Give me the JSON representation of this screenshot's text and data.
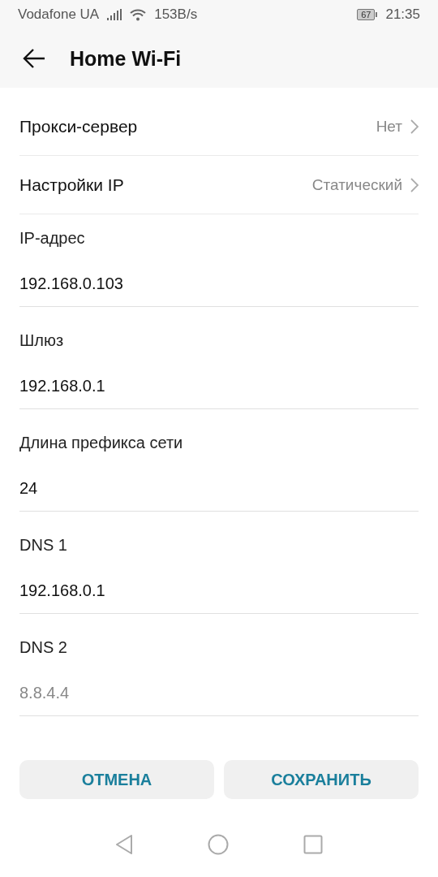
{
  "status_bar": {
    "carrier": "Vodafone UA",
    "speed": "153B/s",
    "battery": "67",
    "time": "21:35"
  },
  "header": {
    "title": "Home Wi-Fi"
  },
  "rows": [
    {
      "label": "Прокси-сервер",
      "value": "Нет"
    },
    {
      "label": "Настройки IP",
      "value": "Статический"
    }
  ],
  "fields": [
    {
      "label": "IP-адрес",
      "value": "192.168.0.103"
    },
    {
      "label": "Шлюз",
      "value": "192.168.0.1"
    },
    {
      "label": "Длина префикса сети",
      "value": "24"
    },
    {
      "label": "DNS 1",
      "value": "192.168.0.1"
    },
    {
      "label": "DNS 2",
      "placeholder": "8.8.4.4"
    }
  ],
  "buttons": [
    "ОТМЕНА",
    "СОХРАНИТЬ"
  ]
}
